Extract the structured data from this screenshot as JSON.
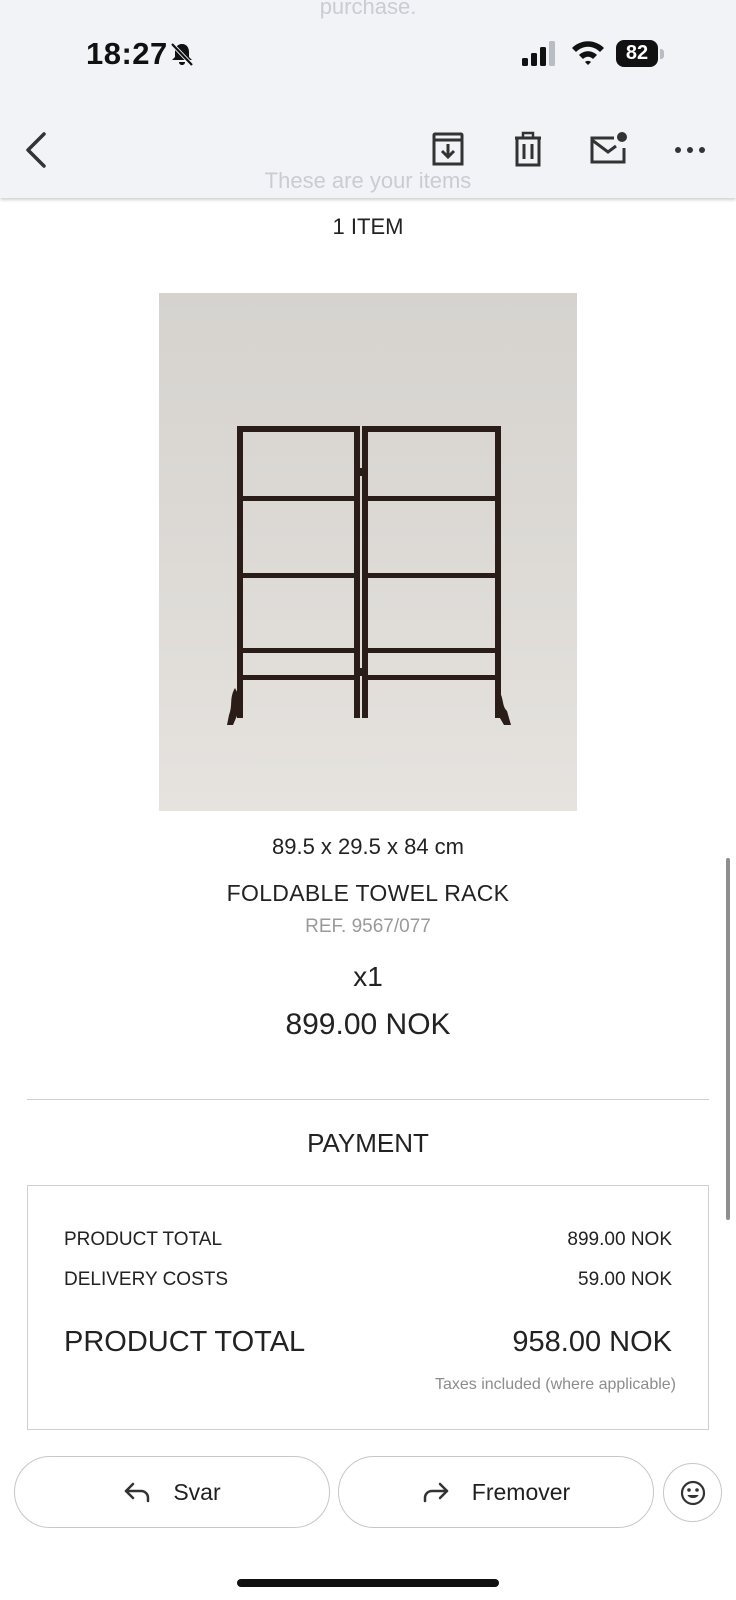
{
  "header": {
    "ghost_top_text": "purchase.",
    "ghost_mid_text": "These are your items",
    "status": {
      "time": "18:27",
      "battery_level": "82"
    },
    "toolbar": {
      "back_icon": "chevron-left-icon",
      "archive_icon": "archive-icon",
      "delete_icon": "trash-icon",
      "mark_unread_icon": "mail-unread-icon",
      "more_icon": "more-horizontal-icon"
    }
  },
  "order": {
    "item_count": "1 ITEM",
    "product": {
      "dimensions": "89.5 x 29.5 x 84 cm",
      "name": "FOLDABLE TOWEL RACK",
      "ref": "REF. 9567/077",
      "quantity": "x1",
      "price": "899.00 NOK"
    }
  },
  "payment": {
    "heading": "PAYMENT",
    "rows": [
      {
        "label": "PRODUCT TOTAL",
        "value": "899.00 NOK"
      },
      {
        "label": "DELIVERY COSTS",
        "value": "59.00 NOK"
      }
    ],
    "total": {
      "label": "PRODUCT TOTAL",
      "value": "958.00 NOK"
    },
    "tax_note": "Taxes included (where applicable)"
  },
  "actions": {
    "reply_label": "Svar",
    "forward_label": "Fremover",
    "emoji_icon": "smiley-icon"
  },
  "colors": {
    "header_bg": "#f1f3f7",
    "text": "#222222",
    "muted": "#9a9a9a",
    "border": "#cfcfcf"
  }
}
